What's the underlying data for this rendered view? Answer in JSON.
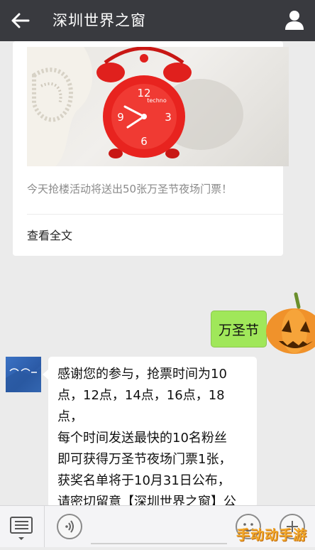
{
  "header": {
    "title": "深圳世界之窗"
  },
  "article": {
    "summary": "今天抢楼活动将送出50张万圣节夜场门票！",
    "read_more": "查看全文",
    "clock_brand": "techno"
  },
  "messages": [
    {
      "from": "me",
      "text": "万圣节"
    },
    {
      "from": "account",
      "text": "感谢您的参与，抢票时间为10\n点，12点，14点，16点，18点，\n每个时间发送最快的10名粉丝\n即可获得万圣节夜场门票1张，\n获奖名单将于10月31日公布，\n请密切留意【深圳世界之窗】公\n众号图文消息！"
    }
  ],
  "watermark": "手动动手游",
  "colors": {
    "header_bg": "#393a3f",
    "sent_bubble": "#a0e75a",
    "chat_bg": "#ebebeb"
  },
  "icons": {
    "back": "arrow-left-icon",
    "profile": "person-icon",
    "menu": "menu-list-icon",
    "voice": "voice-icon",
    "emoji": "emoji-icon",
    "more": "plus-icon"
  }
}
